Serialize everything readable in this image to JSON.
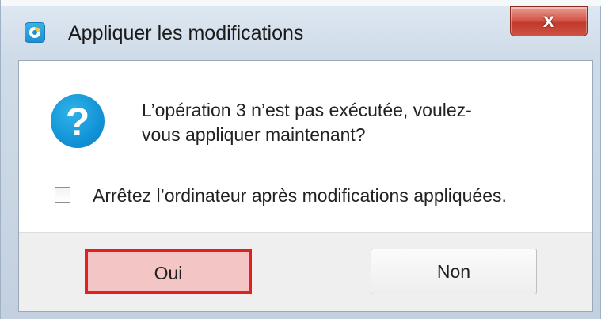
{
  "window": {
    "title": "Appliquer les modifications",
    "close_label": "x"
  },
  "dialog": {
    "icon": "question-icon",
    "icon_glyph": "?",
    "message_line1": "L’opération 3 n’est pas exécutée, voulez-",
    "message_line2": "vous appliquer maintenant?",
    "checkbox_label": "Arrêtez l’ordinateur après modifications appliquées.",
    "checkbox_checked": false
  },
  "buttons": {
    "yes_label": "Oui",
    "no_label": "Non"
  },
  "colors": {
    "accent": "#1393d7",
    "highlight_border": "#e32020",
    "highlight_fill": "#f4c5c5",
    "close_red": "#c0392b"
  }
}
